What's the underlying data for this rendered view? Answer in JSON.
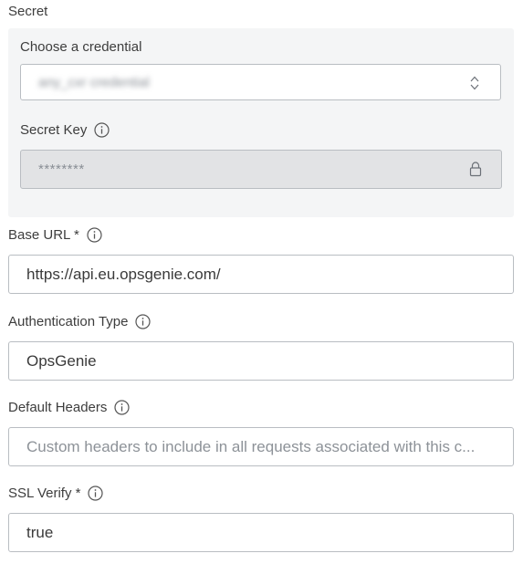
{
  "secret": {
    "section_label": "Secret",
    "credential": {
      "label": "Choose a credential",
      "value": "any_cxr credential"
    },
    "secret_key": {
      "label": "Secret Key",
      "value": "********"
    }
  },
  "fields": {
    "base_url": {
      "label": "Base URL *",
      "value": "https://api.eu.opsgenie.com/"
    },
    "auth_type": {
      "label": "Authentication Type",
      "value": "OpsGenie"
    },
    "default_headers": {
      "label": "Default Headers",
      "placeholder": "Custom headers to include in all requests associated with this c..."
    },
    "ssl_verify": {
      "label": "SSL Verify *",
      "value": "true"
    }
  },
  "icons": {
    "info": "info-circle-icon",
    "select_arrows": "sort-arrows-icon",
    "lock": "lock-icon"
  },
  "colors": {
    "panel_bg": "#f4f5f6",
    "border": "#b9bdc2",
    "locked_bg": "#e2e3e5"
  }
}
